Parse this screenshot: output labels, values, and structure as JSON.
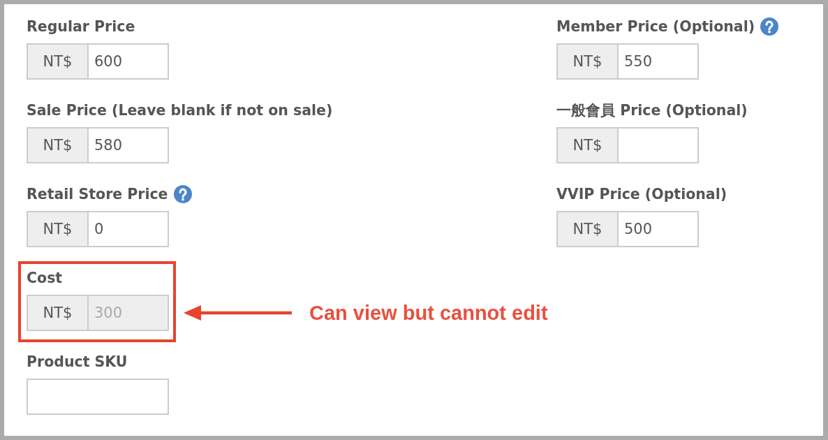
{
  "left_fields": [
    {
      "label": "Regular Price",
      "help": false,
      "prefix": "NT$",
      "value": "600",
      "disabled": false
    },
    {
      "label": "Sale Price (Leave blank if not on sale)",
      "help": false,
      "prefix": "NT$",
      "value": "580",
      "disabled": false
    },
    {
      "label": "Retail Store Price",
      "help": true,
      "prefix": "NT$",
      "value": "0",
      "disabled": false
    },
    {
      "label": "Cost",
      "help": false,
      "prefix": "NT$",
      "value": "300",
      "disabled": true,
      "annotation": "Can view but cannot edit"
    },
    {
      "label": "Product SKU",
      "help": false,
      "disabled": false
    }
  ],
  "right_fields": [
    {
      "label": "Member Price (Optional)",
      "help": true,
      "prefix": "NT$",
      "value": "550",
      "disabled": false
    },
    {
      "label": "一般會員 Price (Optional)",
      "help": false,
      "prefix": "NT$",
      "disabled": false
    },
    {
      "label": "VVIP Price (Optional)",
      "help": false,
      "prefix": "NT$",
      "value": "500",
      "disabled": false
    }
  ]
}
